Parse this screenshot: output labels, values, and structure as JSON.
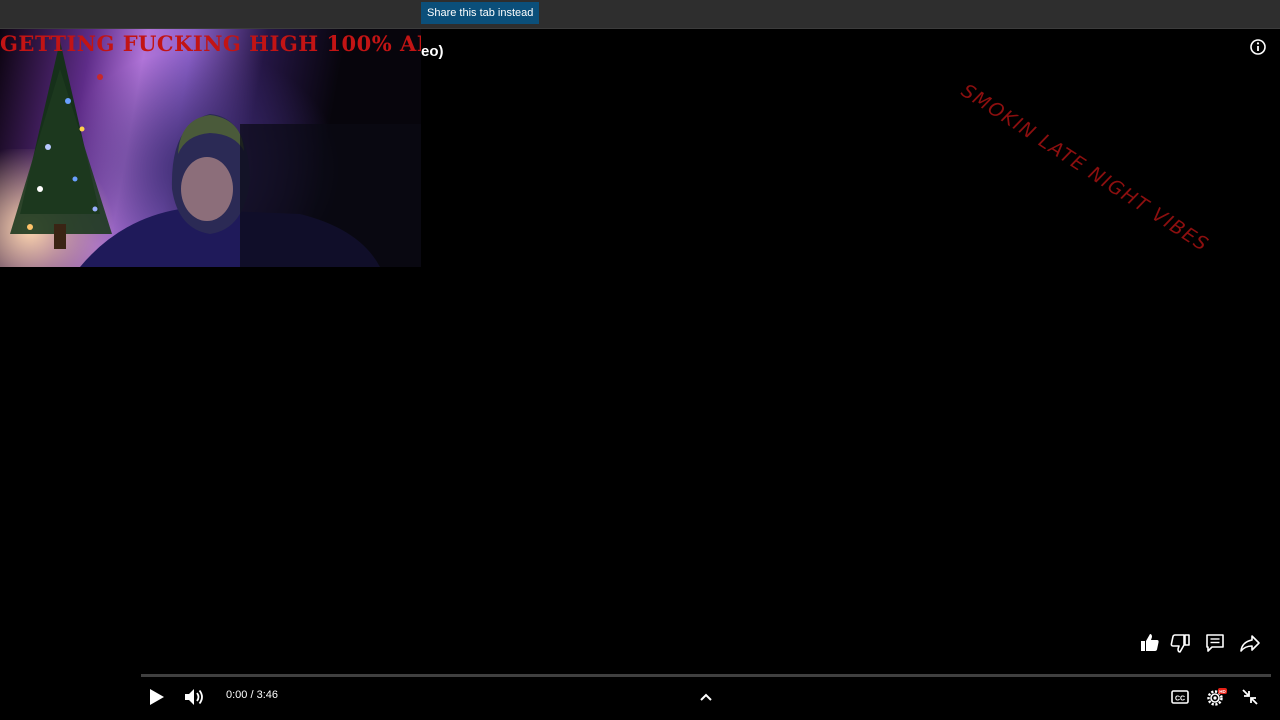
{
  "topbar": {
    "share_label": "Share this tab instead"
  },
  "webcam": {
    "title": "GETTING FUCKING HIGH 100% AI"
  },
  "video": {
    "title_fragment": "eo)",
    "overlay_text": "SMOKIN LATE NIGHT VIBES",
    "progress": 0.0
  },
  "controls": {
    "time_current": "0:00",
    "time_separator": " / ",
    "time_total": "3:46"
  },
  "icons": {
    "info": "info-icon",
    "like": "thumbs-up-icon",
    "dislike": "thumbs-down-icon",
    "comments": "comments-icon",
    "share": "share-icon",
    "play": "play-icon",
    "volume": "volume-icon",
    "expand": "chevron-up-icon",
    "captions": "captions-icon",
    "settings": "settings-icon",
    "exit_fullscreen": "exit-fullscreen-icon"
  },
  "colors": {
    "accent_red": "#c21414",
    "share_button_bg": "#0b4f7a",
    "overlay_text": "#8c0f0f",
    "progress_fill": "#ff0000"
  }
}
